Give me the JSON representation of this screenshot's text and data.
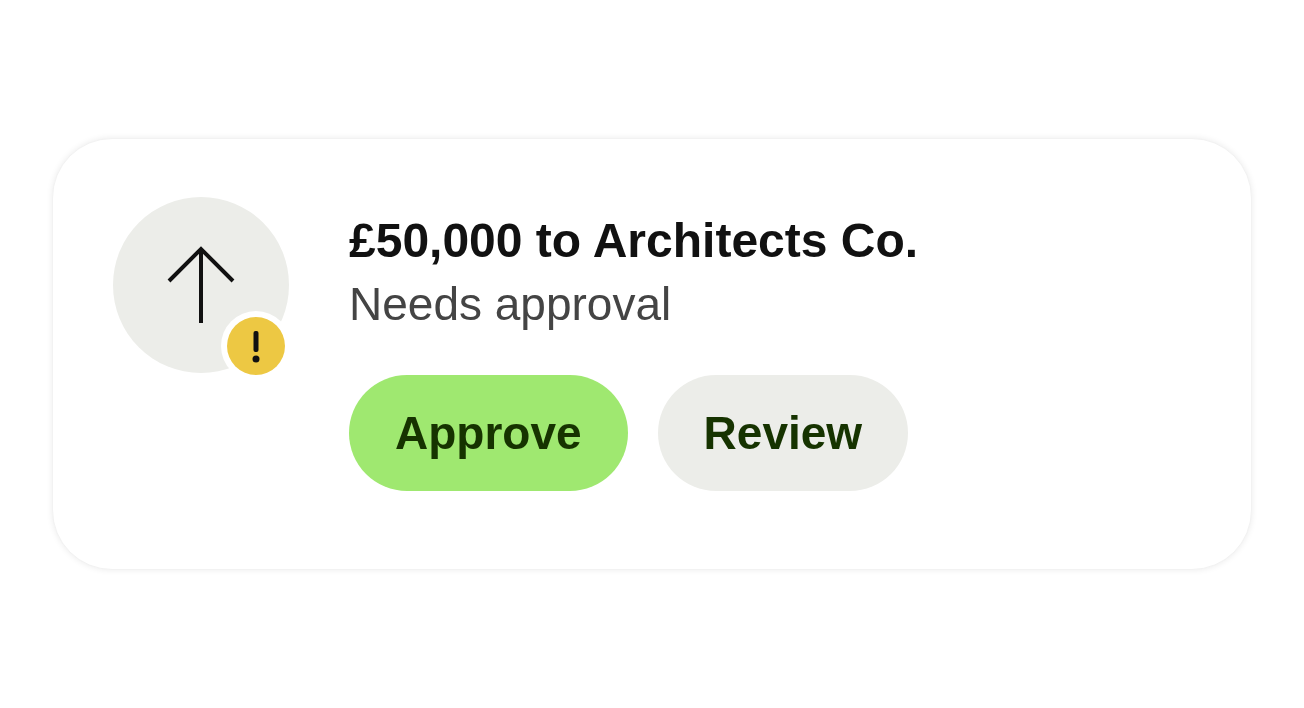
{
  "card": {
    "title": "£50,000 to Architects Co.",
    "status": "Needs approval",
    "warning": true,
    "buttons": [
      {
        "label": "Approve",
        "kind": "primary"
      },
      {
        "label": "Review",
        "kind": "secondary"
      }
    ]
  }
}
